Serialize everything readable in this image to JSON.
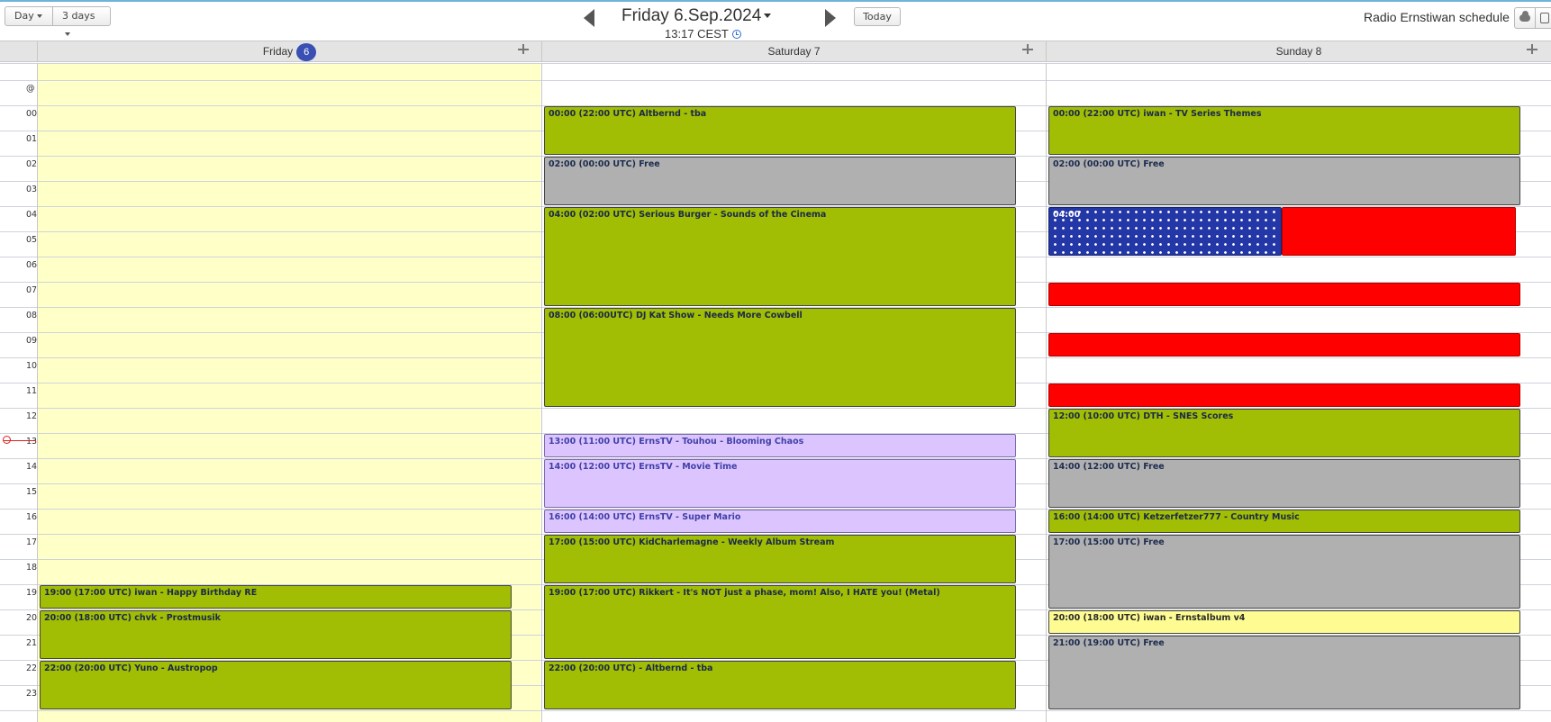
{
  "toolbar": {
    "view_day_label": "Day",
    "view_3days_label": "3 days",
    "date_title": "Friday 6.Sep.2024",
    "time_line": "13:17 CEST",
    "today_label": "Today",
    "app_title": "Radio Ernstiwan schedule"
  },
  "days": [
    {
      "label": "Friday",
      "badge": "6"
    },
    {
      "label": "Saturday 7",
      "badge": ""
    },
    {
      "label": "Sunday 8",
      "badge": ""
    }
  ],
  "hour_labels": [
    "@",
    "00",
    "01",
    "02",
    "03",
    "04",
    "05",
    "06",
    "07",
    "08",
    "09",
    "10",
    "11",
    "12",
    "13",
    "14",
    "15",
    "16",
    "17",
    "18",
    "19",
    "20",
    "21",
    "22",
    "23"
  ],
  "events": {
    "friday": [
      {
        "text": "19:00 (17:00 UTC) iwan - Happy Birthday RE",
        "style": "green",
        "start": 19,
        "end": 20
      },
      {
        "text": "20:00 (18:00 UTC) chvk - Prostmusik",
        "style": "green",
        "start": 20,
        "end": 22
      },
      {
        "text": "22:00 (20:00 UTC) Yuno - Austropop",
        "style": "green",
        "start": 22,
        "end": 24
      }
    ],
    "saturday": [
      {
        "text": "00:00 (22:00 UTC) Altbernd - tba",
        "style": "green",
        "start": 0,
        "end": 2
      },
      {
        "text": "02:00 (00:00 UTC) Free",
        "style": "gray",
        "start": 2,
        "end": 4
      },
      {
        "text": "04:00 (02:00 UTC) Serious Burger - Sounds of the Cinema",
        "style": "green",
        "start": 4,
        "end": 8
      },
      {
        "text": "08:00 (06:00UTC) DJ Kat Show - Needs More Cowbell",
        "style": "green",
        "start": 8,
        "end": 12
      },
      {
        "text": "13:00 (11:00 UTC) ErnsTV - Touhou - Blooming Chaos",
        "style": "purple",
        "start": 13,
        "end": 14
      },
      {
        "text": "14:00 (12:00 UTC) ErnsTV - Movie Time",
        "style": "purple",
        "start": 14,
        "end": 16
      },
      {
        "text": "16:00 (14:00 UTC) ErnsTV - Super Mario",
        "style": "purple",
        "start": 16,
        "end": 17
      },
      {
        "text": "17:00 (15:00 UTC) KidCharlemagne - Weekly Album Stream",
        "style": "green",
        "start": 17,
        "end": 19
      },
      {
        "text": "19:00 (17:00 UTC) Rikkert - It's NOT just a phase, mom! Also, I HATE you! (Metal)",
        "style": "green",
        "start": 19,
        "end": 22
      },
      {
        "text": "22:00 (20:00 UTC) - Altbernd - tba",
        "style": "green",
        "start": 22,
        "end": 24
      }
    ],
    "sunday": [
      {
        "text": "00:00 (22:00 UTC) iwan - TV Series Themes",
        "style": "green",
        "start": 0,
        "end": 2
      },
      {
        "text": "02:00 (00:00 UTC) Free",
        "style": "gray",
        "start": 2,
        "end": 4
      },
      {
        "text": "04:00",
        "style": "flag",
        "start": 4,
        "end": 6,
        "part": "left"
      },
      {
        "text": "",
        "style": "red",
        "start": 4,
        "end": 6,
        "part": "right"
      },
      {
        "text": "",
        "style": "red",
        "start": 7,
        "end": 8
      },
      {
        "text": "",
        "style": "red",
        "start": 9,
        "end": 10
      },
      {
        "text": "",
        "style": "red",
        "start": 11,
        "end": 12
      },
      {
        "text": "12:00 (10:00 UTC) DTH - SNES Scores",
        "style": "green",
        "start": 12,
        "end": 14
      },
      {
        "text": "14:00 (12:00 UTC) Free",
        "style": "gray",
        "start": 14,
        "end": 16
      },
      {
        "text": "16:00 (14:00 UTC) Ketzerfetzer777 - Country Music",
        "style": "green",
        "start": 16,
        "end": 17
      },
      {
        "text": "17:00 (15:00 UTC) Free",
        "style": "gray",
        "start": 17,
        "end": 20
      },
      {
        "text": "20:00 (18:00 UTC) iwan - Ernstalbum v4",
        "style": "yellow",
        "start": 20,
        "end": 21
      },
      {
        "text": "21:00 (19:00 UTC) Free",
        "style": "gray",
        "start": 21,
        "end": 24
      }
    ]
  }
}
